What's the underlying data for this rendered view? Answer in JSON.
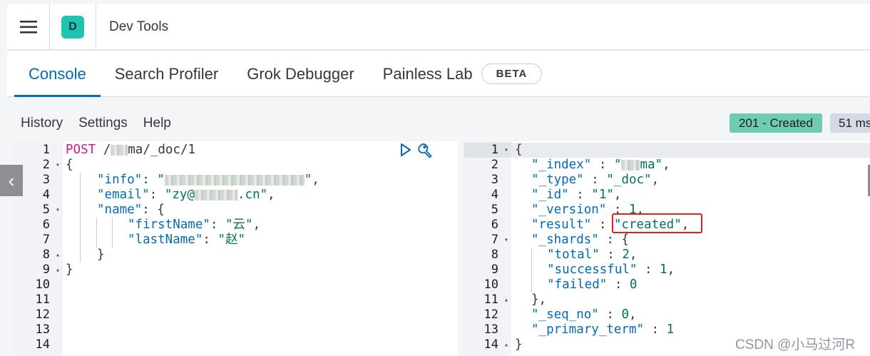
{
  "header": {
    "menu_icon": "hamburger-icon",
    "space_initial": "D",
    "app_title": "Dev Tools",
    "space_color": "#20c2b2"
  },
  "tabs": [
    {
      "label": "Console",
      "active": true
    },
    {
      "label": "Search Profiler",
      "active": false
    },
    {
      "label": "Grok Debugger",
      "active": false
    },
    {
      "label": "Painless Lab",
      "active": false,
      "badge": "BETA"
    }
  ],
  "request_bar": {
    "history_label": "History",
    "settings_label": "Settings",
    "help_label": "Help",
    "status": "201 - Created",
    "status_color": "#6dccb1",
    "time": "51 ms"
  },
  "request_editor": {
    "line_numbers": [
      "1",
      "2",
      "3",
      "4",
      "5",
      "6",
      "7",
      "8",
      "9",
      "10",
      "11",
      "12",
      "13",
      "14"
    ],
    "method": "POST",
    "path_prefix": "/",
    "path_suffix": "ma/_doc/1",
    "info_key": "\"info\"",
    "email_key": "\"email\"",
    "email_prefix": "\"zy@",
    "email_suffix": ".cn\"",
    "name_key": "\"name\"",
    "firstname_key": "\"firstName\"",
    "firstname_value": "\"云\"",
    "lastname_key": "\"lastName\"",
    "lastname_value": "\"赵\"",
    "run_icon": "play-icon",
    "wrench_icon": "wrench-icon"
  },
  "response_editor": {
    "line_numbers": [
      "1",
      "2",
      "3",
      "4",
      "5",
      "6",
      "7",
      "8",
      "9",
      "10",
      "11",
      "12",
      "13",
      "14"
    ],
    "index_key": "\"_index\"",
    "index_value_suffix": "ma\"",
    "type_key": "\"_type\"",
    "type_value": "\"_doc\"",
    "id_key": "\"_id\"",
    "id_value": "\"1\"",
    "version_key": "\"_version\"",
    "version_value": "1",
    "result_key": "\"result\"",
    "result_value": "\"created\"",
    "shards_key": "\"_shards\"",
    "total_key": "\"total\"",
    "total_value": "2",
    "successful_key": "\"successful\"",
    "successful_value": "1",
    "failed_key": "\"failed\"",
    "failed_value": "0",
    "seq_no_key": "\"_seq_no\"",
    "seq_no_value": "0",
    "primary_term_key": "\"_primary_term\"",
    "primary_term_value": "1"
  },
  "watermark": "CSDN @小马过河R"
}
